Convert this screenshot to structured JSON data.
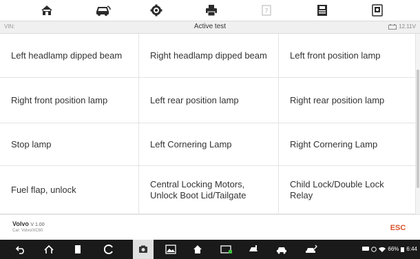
{
  "toolbar": {
    "icons": [
      "home-icon",
      "vehicle-swap-icon",
      "settings-icon",
      "print-icon",
      "help-icon",
      "save-icon",
      "data-manager-icon"
    ]
  },
  "header": {
    "vin_label": "VIN:",
    "title": "Active test",
    "voltage": "12.11V"
  },
  "tests": [
    "Left headlamp dipped beam",
    "Right headlamp dipped beam",
    "Left front position lamp",
    "Right front position lamp",
    "Left rear position lamp",
    "Right rear position lamp",
    "Stop lamp",
    "Left Cornering Lamp",
    "Right Cornering Lamp",
    "Fuel flap, unlock",
    "Central Locking Motors, Unlock Boot Lid/Tailgate",
    "Child Lock/Double Lock Relay"
  ],
  "footer": {
    "vehicle_make": "Volvo",
    "vehicle_version": "V 1.00",
    "vehicle_car": "Car: Volvo/XC60",
    "esc_label": "ESC"
  },
  "navbar": {
    "battery": "66%",
    "time": "6:44"
  },
  "colors": {
    "accent": "#d9502a",
    "toolbar_icon": "#2b2b2b",
    "navbar_bg": "#1a1a1a"
  }
}
